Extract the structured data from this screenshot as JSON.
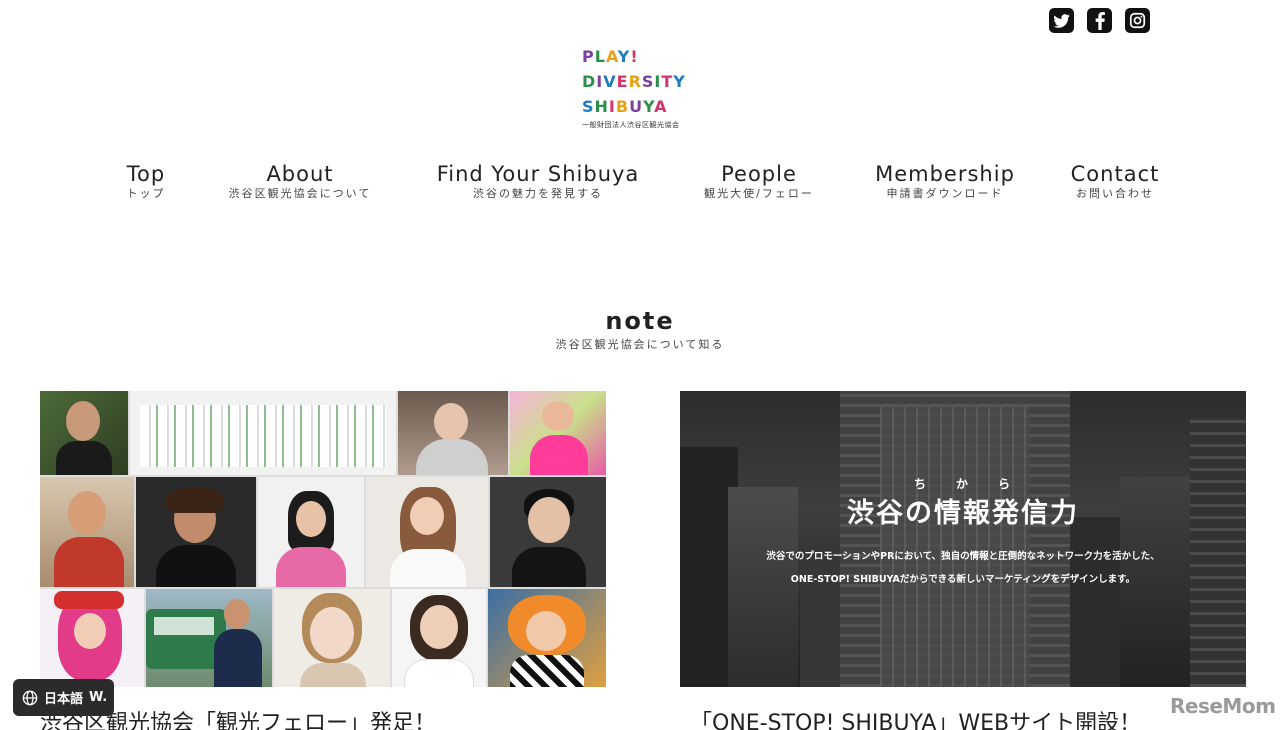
{
  "social": {
    "twitter_icon": "twitter-icon",
    "facebook_icon": "facebook-icon",
    "instagram_icon": "instagram-icon"
  },
  "logo": {
    "line1": "PLAY!",
    "line2": "DIVERSITY",
    "line3": "SHIBUYA",
    "sub": "一般財団法人渋谷区観光協会",
    "colors": [
      "#7b3fa0",
      "#e8a21a",
      "#2a8f4a",
      "#d6336c",
      "#1f7bc0",
      "#e2c21b"
    ]
  },
  "nav": {
    "items": [
      {
        "en": "Top",
        "ja": "トップ"
      },
      {
        "en": "About",
        "ja": "渋谷区観光協会について"
      },
      {
        "en": "Find Your Shibuya",
        "ja": "渋谷の魅力を発見する"
      },
      {
        "en": "People",
        "ja": "観光大使/フェロー"
      },
      {
        "en": "Membership",
        "ja": "申請書ダウンロード"
      },
      {
        "en": "Contact",
        "ja": "お問い合わせ"
      }
    ]
  },
  "section": {
    "title": "note",
    "subtitle": "渋谷区観光協会について知る"
  },
  "cards": [
    {
      "title": "渋谷区観光協会「観光フェロー」発足！"
    },
    {
      "title": "「ONE-STOP! SHIBUYA」WEBサイト開設！",
      "image": {
        "ruby": "ち　　か　　ら",
        "headline": "渋谷の情報発信力",
        "line1": "渋谷でのプロモーションやPRにおいて、独自の情報と圧倒的なネットワーク力を活かした、",
        "line2": "ONE-STOP! SHIBUYAだからできる新しいマーケティングをデザインします。"
      }
    }
  ],
  "language_widget": {
    "label": "日本語",
    "suffix": "W.",
    "icon": "globe-icon"
  },
  "watermark": "ReseMom"
}
